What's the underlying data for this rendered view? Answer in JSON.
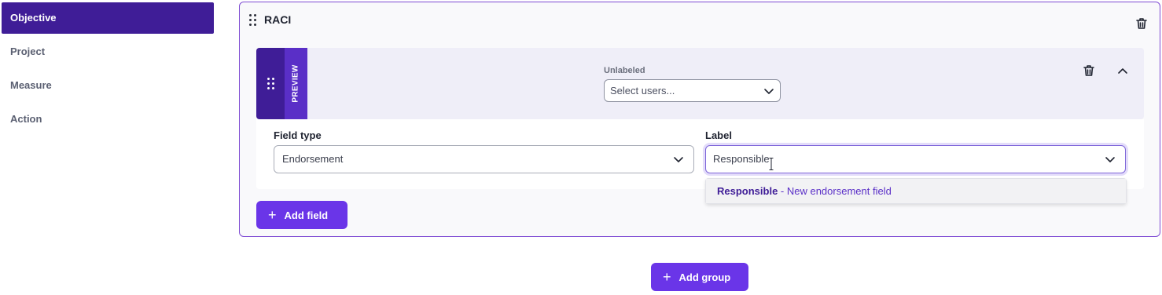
{
  "sidebar": {
    "items": [
      {
        "label": "Objective",
        "active": true
      },
      {
        "label": "Project",
        "active": false
      },
      {
        "label": "Measure",
        "active": false
      },
      {
        "label": "Action",
        "active": false
      }
    ]
  },
  "group": {
    "title": "RACI",
    "field": {
      "preview_tab_label": "PREVIEW",
      "preview_field_label": "Unlabeled",
      "preview_select_placeholder": "Select users...",
      "field_type_label": "Field type",
      "field_type_value": "Endorsement",
      "label_label": "Label",
      "label_value": "Responsible"
    },
    "suggestion": {
      "highlight": "Responsible",
      "rest": " - New endorsement field"
    },
    "add_field_label": "Add field"
  },
  "add_group_label": "Add group",
  "colors": {
    "accent": "#6a35e8",
    "sidebar_active": "#3f1d97",
    "group_border": "#7e4bd3"
  },
  "icons": [
    "drag-handle-icon",
    "trash-icon",
    "chevron-up-icon",
    "chevron-down-icon",
    "plus-icon",
    "text-cursor-icon"
  ]
}
